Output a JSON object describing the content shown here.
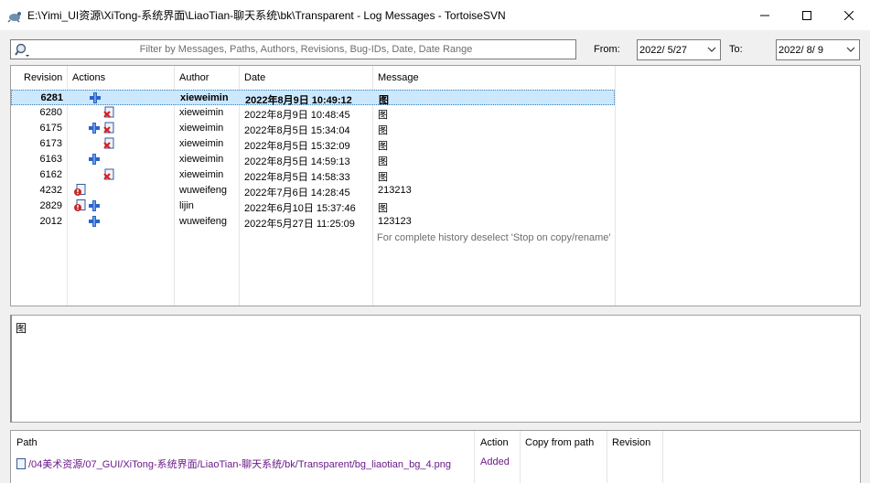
{
  "window": {
    "title": "E:\\Yimi_UI资源\\XiTong-系统界面\\LiaoTian-聊天系统\\bk\\Transparent - Log Messages - TortoiseSVN"
  },
  "filter": {
    "placeholder": "Filter by Messages, Paths, Authors, Revisions, Bug-IDs, Date, Date Range",
    "from_label": "From:",
    "from_value": "2022/  5/27",
    "to_label": "To:",
    "to_value": "2022/  8/  9"
  },
  "log": {
    "columns": [
      "Revision",
      "Actions",
      "Author",
      "Date",
      "Message"
    ],
    "rows": [
      {
        "revision": "6281",
        "actions": [
          "added"
        ],
        "author": "xieweimin",
        "date": "2022年8月9日 10:49:12",
        "message": "图",
        "selected": true
      },
      {
        "revision": "6280",
        "actions": [
          "deleted"
        ],
        "author": "xieweimin",
        "date": "2022年8月9日 10:48:45",
        "message": "图"
      },
      {
        "revision": "6175",
        "actions": [
          "added",
          "deleted"
        ],
        "author": "xieweimin",
        "date": "2022年8月5日 15:34:04",
        "message": "图"
      },
      {
        "revision": "6173",
        "actions": [
          "deleted"
        ],
        "author": "xieweimin",
        "date": "2022年8月5日 15:32:09",
        "message": "图"
      },
      {
        "revision": "6163",
        "actions": [
          "added"
        ],
        "author": "xieweimin",
        "date": "2022年8月5日 14:59:13",
        "message": "图"
      },
      {
        "revision": "6162",
        "actions": [
          "deleted"
        ],
        "author": "xieweimin",
        "date": "2022年8月5日 14:58:33",
        "message": "图"
      },
      {
        "revision": "4232",
        "actions": [
          "modified"
        ],
        "author": "wuweifeng",
        "date": "2022年7月6日 14:28:45",
        "message": "213213"
      },
      {
        "revision": "2829",
        "actions": [
          "modified",
          "added"
        ],
        "author": "lijin",
        "date": "2022年6月10日 15:37:46",
        "message": "图"
      },
      {
        "revision": "2012",
        "actions": [
          "added"
        ],
        "author": "wuweifeng",
        "date": "2022年5月27日 11:25:09",
        "message": "123123"
      }
    ],
    "note": "For complete history deselect 'Stop on copy/rename'"
  },
  "message_pane": {
    "text": "图"
  },
  "paths": {
    "columns": [
      "Path",
      "Action",
      "Copy from path",
      "Revision"
    ],
    "rows": [
      {
        "path": "/04美术资源/07_GUI/XiTong-系统界面/LiaoTian-聊天系统/bk/Transparent/bg_liaotian_bg_4.png",
        "action": "Added",
        "copy_from": "",
        "revision": ""
      }
    ]
  },
  "colors": {
    "selection": "#cce8ff",
    "added_icon": "#2a63c9",
    "deleted_icon": "#d42020",
    "path_text": "#6b1a8a",
    "note_text": "#6d6d6d"
  }
}
